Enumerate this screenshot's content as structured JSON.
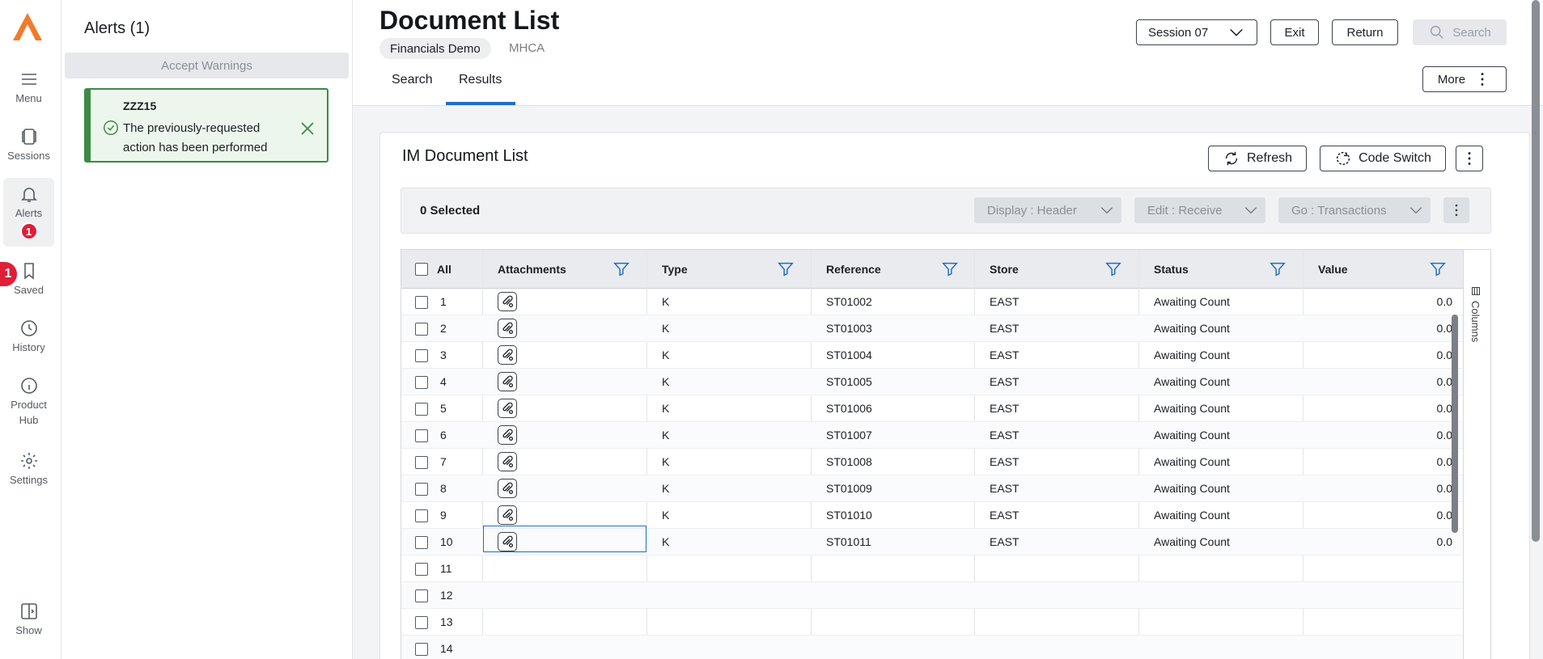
{
  "rail": {
    "items": [
      {
        "label": "Menu",
        "icon": "menu-icon"
      },
      {
        "label": "Sessions",
        "icon": "sessions-icon"
      },
      {
        "label": "Alerts",
        "icon": "bell-icon",
        "badge": "1"
      },
      {
        "label": "Saved",
        "icon": "bookmark-icon",
        "badge": "1"
      },
      {
        "label": "History",
        "icon": "clock-icon"
      },
      {
        "label": "Product",
        "label2": "Hub",
        "icon": "info-icon"
      },
      {
        "label": "Settings",
        "icon": "gear-icon"
      },
      {
        "label": "Show",
        "icon": "panel-icon"
      }
    ]
  },
  "alerts": {
    "title": "Alerts (1)",
    "accept_label": "Accept Warnings",
    "card": {
      "code": "ZZZ15",
      "message": "The previously-requested action has been performed"
    }
  },
  "header": {
    "title": "Document List",
    "company": "Financials Demo",
    "module": "MHCA",
    "tabs": [
      "Search",
      "Results"
    ],
    "active_tab": "Results",
    "session_label": "Session 07",
    "exit_label": "Exit",
    "return_label": "Return",
    "search_label": "Search",
    "more_label": "More"
  },
  "card": {
    "title": "IM Document List",
    "refresh_label": "Refresh",
    "code_switch_label": "Code Switch",
    "selected_label": "0 Selected",
    "display_label": "Display : Header",
    "edit_label": "Edit : Receive",
    "go_label": "Go : Transactions"
  },
  "grid": {
    "columns": [
      "All",
      "Attachments",
      "Type",
      "Reference",
      "Store",
      "Status",
      "Value"
    ],
    "side_label": "Columns",
    "rows": [
      {
        "n": "1",
        "type": "K",
        "ref": "ST01002",
        "store": "EAST",
        "status": "Awaiting Count",
        "value": "0.0"
      },
      {
        "n": "2",
        "type": "K",
        "ref": "ST01003",
        "store": "EAST",
        "status": "Awaiting Count",
        "value": "0.0"
      },
      {
        "n": "3",
        "type": "K",
        "ref": "ST01004",
        "store": "EAST",
        "status": "Awaiting Count",
        "value": "0.0"
      },
      {
        "n": "4",
        "type": "K",
        "ref": "ST01005",
        "store": "EAST",
        "status": "Awaiting Count",
        "value": "0.0"
      },
      {
        "n": "5",
        "type": "K",
        "ref": "ST01006",
        "store": "EAST",
        "status": "Awaiting Count",
        "value": "0.0"
      },
      {
        "n": "6",
        "type": "K",
        "ref": "ST01007",
        "store": "EAST",
        "status": "Awaiting Count",
        "value": "0.0"
      },
      {
        "n": "7",
        "type": "K",
        "ref": "ST01008",
        "store": "EAST",
        "status": "Awaiting Count",
        "value": "0.0"
      },
      {
        "n": "8",
        "type": "K",
        "ref": "ST01009",
        "store": "EAST",
        "status": "Awaiting Count",
        "value": "0.0"
      },
      {
        "n": "9",
        "type": "K",
        "ref": "ST01010",
        "store": "EAST",
        "status": "Awaiting Count",
        "value": "0.0"
      },
      {
        "n": "10",
        "type": "K",
        "ref": "ST01011",
        "store": "EAST",
        "status": "Awaiting Count",
        "value": "0.0"
      },
      {
        "n": "11",
        "type": "",
        "ref": "",
        "store": "",
        "status": "",
        "value": ""
      },
      {
        "n": "12",
        "type": "",
        "ref": "",
        "store": "",
        "status": "",
        "value": ""
      },
      {
        "n": "13",
        "type": "",
        "ref": "",
        "store": "",
        "status": "",
        "value": ""
      },
      {
        "n": "14",
        "type": "",
        "ref": "",
        "store": "",
        "status": "",
        "value": ""
      }
    ]
  },
  "colors": {
    "accent": "#1f6fbf",
    "success": "#3c8a45",
    "badge": "#e01e37",
    "logo": "#f07b2a"
  }
}
